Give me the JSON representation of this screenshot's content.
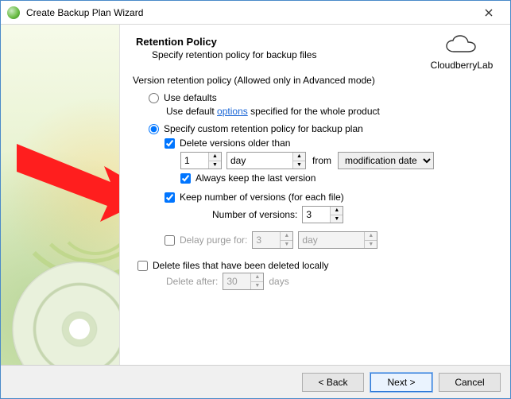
{
  "window": {
    "title": "Create Backup Plan Wizard"
  },
  "brand": {
    "name": "CloudberryLab"
  },
  "header": {
    "title": "Retention Policy",
    "subtitle": "Specify retention policy for backup files"
  },
  "policy": {
    "section_note": "Version retention policy (Allowed only in Advanced mode)",
    "use_defaults": {
      "label": "Use defaults",
      "note_prefix": "Use default ",
      "note_link": "options",
      "note_suffix": " specified for the whole product"
    },
    "custom": {
      "label": "Specify custom retention policy for backup plan",
      "delete_older": {
        "label": "Delete versions older than",
        "amount": "1",
        "unit": "day",
        "from_label": "from",
        "from_value": "modification date"
      },
      "always_keep_last": {
        "label": "Always keep the last version"
      },
      "keep_versions": {
        "label": "Keep number of versions (for each file)",
        "count_label": "Number of versions:",
        "count": "3"
      },
      "delay_purge": {
        "label": "Delay purge for:",
        "amount": "3",
        "unit": "day"
      }
    },
    "delete_local": {
      "label": "Delete files that have been deleted locally",
      "after_label": "Delete after:",
      "days": "30",
      "days_suffix": "days"
    }
  },
  "footer": {
    "back": "< Back",
    "next": "Next >",
    "cancel": "Cancel"
  }
}
